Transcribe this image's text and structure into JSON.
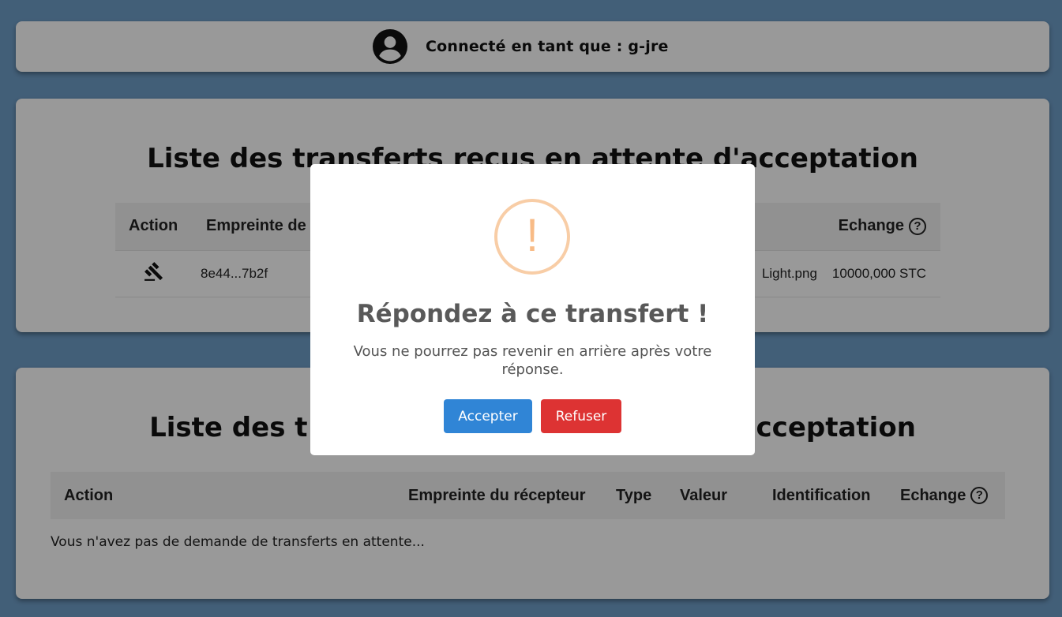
{
  "header": {
    "user_label": "Connecté en tant que : g-jre",
    "avatar_icon": "account-circle-icon"
  },
  "received": {
    "title": "Liste des transferts reçus en attente d'acceptation",
    "columns": [
      "Action",
      "Empreinte de",
      "Echange"
    ],
    "rows": [
      {
        "action_icon": "gavel-icon",
        "fingerprint": "8e44...7b2f",
        "identification": "Light.png",
        "exchange": "10000,000 STC"
      }
    ]
  },
  "sent": {
    "title_left": "Liste des t",
    "title_right": "cceptation",
    "columns": [
      "Action",
      "Empreinte du récepteur",
      "Type",
      "Valeur",
      "Identification",
      "Echange"
    ],
    "empty_message": "Vous n'avez pas de demande de transferts en attente..."
  },
  "modal": {
    "icon": "!",
    "title": "Répondez à ce transfert !",
    "text": "Vous ne pourrez pas revenir en arrière après votre réponse.",
    "accept_label": "Accepter",
    "refuse_label": "Refuser",
    "accept_color": "#3085d6",
    "refuse_color": "#dd3333"
  },
  "help_icon": "?"
}
